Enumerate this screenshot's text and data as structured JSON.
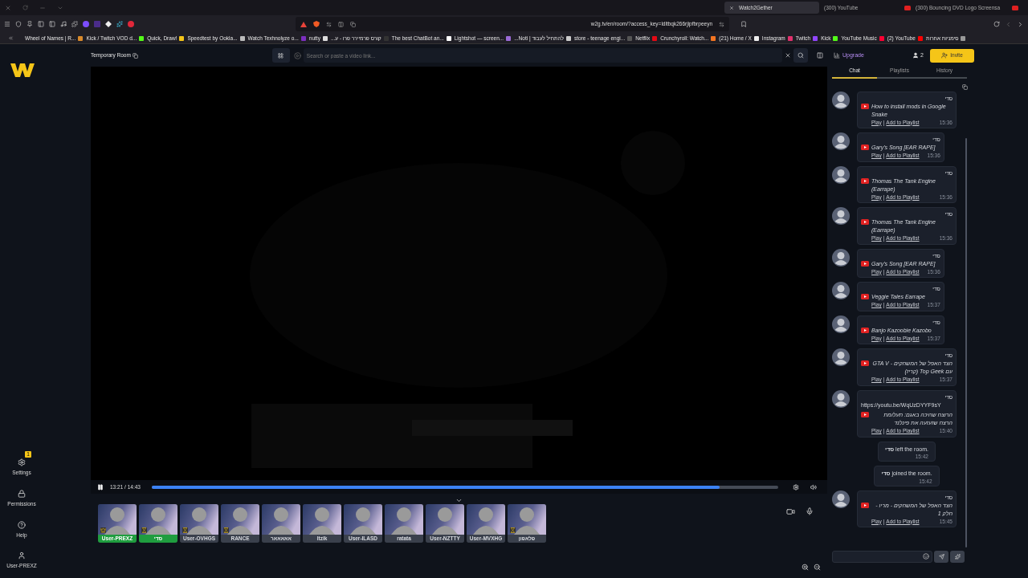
{
  "browser": {
    "tabs": [
      {
        "title": "Watch2Gether",
        "selected": true
      },
      {
        "title": "(300) YouTube",
        "selected": false
      },
      {
        "title": "(300) Bouncing DVD Logo Screensa",
        "selected": false
      }
    ],
    "url": "w2g.tv/en/room/?access_key=ldltbqk266rjipfbrpeeyn",
    "bookmarks": [
      {
        "label": "Wheel of Names | R...",
        "color": "#d98a2b"
      },
      {
        "label": "Kick / Twitch VOD d...",
        "color": "#53fc18"
      },
      {
        "label": "Quick, Draw!",
        "color": "#f5c518"
      },
      {
        "label": "Speedtest by Ookla...",
        "color": "#bbbbbb"
      },
      {
        "label": "Watch Texhnolyze o...",
        "color": "#7b2fbe"
      },
      {
        "label": "nutty",
        "color": "#dddddd"
      },
      {
        "label": "קורס פרמיירר פרו - ע...",
        "color": "#333333"
      },
      {
        "label": "The best ChatBot an...",
        "color": "#ffffff"
      },
      {
        "label": "Lightshot — screen...",
        "color": "#9b6bd6"
      },
      {
        "label": "להתחיל לעבוד | Noti...",
        "color": "#cccccc"
      },
      {
        "label": "store - teenage engi...",
        "color": "#555555"
      },
      {
        "label": "Netflix",
        "color": "#e50914"
      },
      {
        "label": "Crunchyroll: Watch...",
        "color": "#f47521"
      },
      {
        "label": "(21) Home / X",
        "color": "#eeeeee"
      },
      {
        "label": "Instagram",
        "color": "#e1306c"
      },
      {
        "label": "Twitch",
        "color": "#9146ff"
      },
      {
        "label": "Kick",
        "color": "#53fc18"
      },
      {
        "label": "YouTube Music",
        "color": "#ff0033"
      },
      {
        "label": "(2) YouTube",
        "color": "#ff0000"
      },
      {
        "label": "סימניות אחרות",
        "color": "#999999"
      }
    ]
  },
  "sidebar": {
    "items": [
      {
        "kind": "settings",
        "label": "Settings",
        "badge": "1"
      },
      {
        "kind": "lock",
        "label": "Permissions"
      },
      {
        "kind": "help",
        "label": "Help"
      },
      {
        "kind": "user",
        "label": "User-PREXZ"
      }
    ]
  },
  "room": {
    "title": "Temporary Room",
    "search": {
      "placeholder": "Search or paste a video link..."
    },
    "upgrade": "Upgrade",
    "user_count": "2",
    "invite": "Invite"
  },
  "player": {
    "playing": true,
    "time": "13:21 / 14:43",
    "level": 0.907
  },
  "users": [
    {
      "kind": "crown",
      "name": "User-PREXZ",
      "highlighted": true
    },
    {
      "kind": "hourglass",
      "name": "סדי",
      "highlighted": true
    },
    {
      "kind": "hourglass",
      "name": "User-OVHGS",
      "highlighted": false
    },
    {
      "kind": "hourglass",
      "name": "RANCE",
      "highlighted": false
    },
    {
      "kind": "plain",
      "name": "אאאאאר",
      "highlighted": false
    },
    {
      "kind": "plain",
      "name": "Itzik",
      "highlighted": false
    },
    {
      "kind": "plain",
      "name": "User-ILASD",
      "highlighted": false
    },
    {
      "kind": "plain",
      "name": "ratata",
      "highlighted": false
    },
    {
      "kind": "plain",
      "name": "User-NZTTY",
      "highlighted": false
    },
    {
      "kind": "plain",
      "name": "User-MVXHG",
      "highlighted": false
    },
    {
      "kind": "hourglass",
      "name": "פלאפון",
      "highlighted": false
    }
  ],
  "chat": {
    "tabs": [
      {
        "label": "Chat",
        "selected": true
      },
      {
        "label": "Playlists",
        "selected": false
      },
      {
        "label": "History",
        "selected": false
      }
    ],
    "separator": "|",
    "messages": [
      {
        "kind": "video",
        "sender": "סדי",
        "title": "How to install mods in Google Snake",
        "play": "Play",
        "add": "Add to Playlist",
        "time": "15:36"
      },
      {
        "kind": "video",
        "sender": "סדי",
        "title": "Gary's Song [EAR RAPE]",
        "play": "Play",
        "add": "Add to Playlist",
        "time": "15:36"
      },
      {
        "kind": "video",
        "sender": "סדי",
        "title": "Thomas The Tank Engine (Earrape)",
        "play": "Play",
        "add": "Add to Playlist",
        "time": "15:36"
      },
      {
        "kind": "video",
        "sender": "סדי",
        "title": "Thomas The Tank Engine (Earrape)",
        "play": "Play",
        "add": "Add to Playlist",
        "time": "15:36"
      },
      {
        "kind": "video",
        "sender": "סדי",
        "title": "Gary's Song [EAR RAPE]",
        "play": "Play",
        "add": "Add to Playlist",
        "time": "15:36"
      },
      {
        "kind": "video",
        "sender": "סדי",
        "title": "Veggie Tales Earrape",
        "play": "Play",
        "add": "Add to Playlist",
        "time": "15:37"
      },
      {
        "kind": "video",
        "sender": "סדי",
        "title": "Banjo Kazoobie Kazobo",
        "play": "Play",
        "add": "Add to Playlist",
        "time": "15:37"
      },
      {
        "kind": "video",
        "sender": "סדי",
        "title": "הצד האפל של המשחקים - GTA V עם Top Geek (קריז)",
        "play": "Play",
        "add": "Add to Playlist",
        "time": "15:37"
      },
      {
        "kind": "video",
        "sender": "סדי",
        "url": "https://youtu.be/WqUzDYYF9sY",
        "title": "הרוצח שהיכה באגם: תעלומת הרצח שזעזעה את פינלנד",
        "play": "Play",
        "add": "Add to Playlist",
        "time": "15:40"
      },
      {
        "kind": "event",
        "text": "**סדי** left the room.",
        "time": "15:42"
      },
      {
        "kind": "event",
        "text": "**סדי** joined the room.",
        "time": "15:42"
      },
      {
        "kind": "video",
        "sender": "סדי",
        "title": "הצד האפל של המשחקים - מריו - חלק 1",
        "play": "Play",
        "add": "Add to Playlist",
        "time": "15:45"
      }
    ]
  }
}
